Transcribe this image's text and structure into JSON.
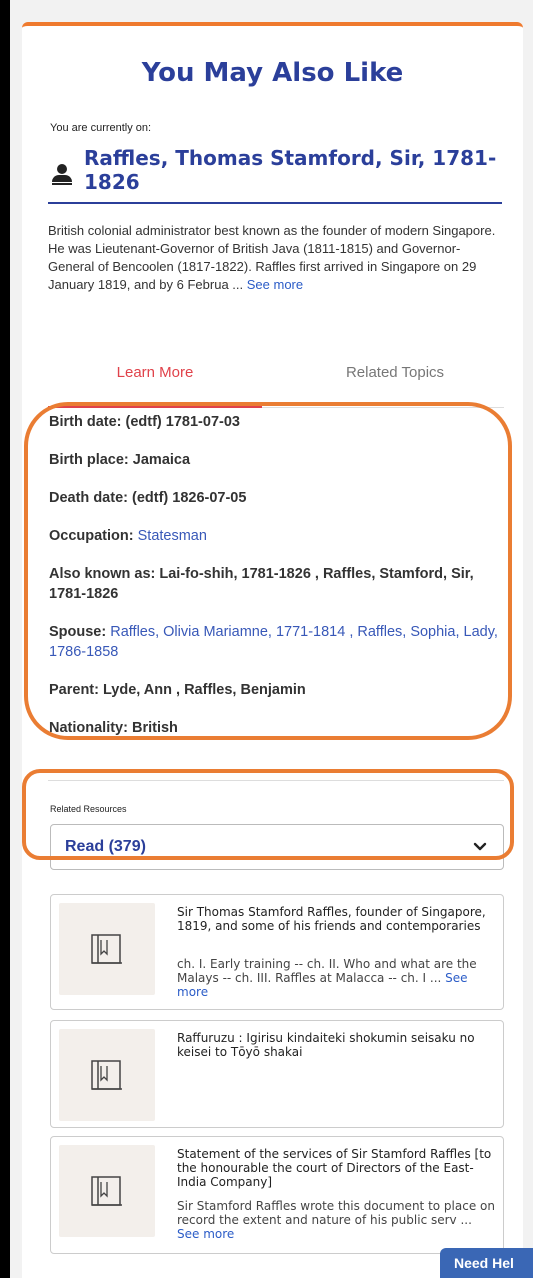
{
  "title": "You May Also Like",
  "current": {
    "label": "You are currently on:",
    "name": "Raffles, Thomas Stamford, Sir, 1781-1826",
    "icon": "person-icon"
  },
  "description": {
    "text": "British colonial administrator best known as the founder of modern Singapore. He was Lieutenant-Governor of British Java (1811-1815) and Governor-General of Bencoolen (1817-1822). Raffles first arrived in Singapore on 29 January 1819, and by 6 Februa ... ",
    "more": "See more"
  },
  "tabs": [
    {
      "label": "Learn More",
      "active": true
    },
    {
      "label": "Related Topics",
      "active": false
    }
  ],
  "details": {
    "birth_date": "Birth date: (edtf) 1781-07-03",
    "birth_place": "Birth place: Jamaica",
    "death_date": "Death date: (edtf) 1826-07-05",
    "occupation_label": "Occupation: ",
    "occupation_value": "Statesman",
    "aka": "Also known as: Lai-fo-shih, 1781-1826 , Raffles, Stamford, Sir, 1781-1826",
    "spouse_label": "Spouse: ",
    "spouse_value": "Raffles, Olivia Mariamne, 1771-1814 , Raffles, Sophia, Lady, 1786-1858",
    "parent": "Parent: Lyde, Ann , Raffles, Benjamin",
    "nationality": "Nationality: British"
  },
  "related": {
    "label": "Related Resources",
    "selected": "Read (379)"
  },
  "cards": [
    {
      "title": "Sir Thomas Stamford Raffles, founder of Singapore, 1819, and some of his friends and contemporaries",
      "desc": "ch. I. Early training -- ch. II. Who and what are the Malays -- ch. III. Raffles at Malacca -- ch. I ... ",
      "more": "See more"
    },
    {
      "title": "Raffuruzu : Igirisu kindaiteki shokumin seisaku no keisei to Tōyō shakai",
      "desc": "",
      "more": ""
    },
    {
      "title": "Statement of the services of Sir Stamford Raffles [to the honourable the court of Directors of the East-India Company]",
      "desc": "Sir Stamford Raffles wrote this document to place on record the extent and nature of his public serv ... ",
      "more": "See more"
    }
  ],
  "help_button": "Need Hel",
  "colors": {
    "accent_orange": "#ea7d33",
    "brand_blue": "#2b3f9a",
    "tab_red": "#e0424a",
    "link_blue": "#2b5cc7"
  }
}
